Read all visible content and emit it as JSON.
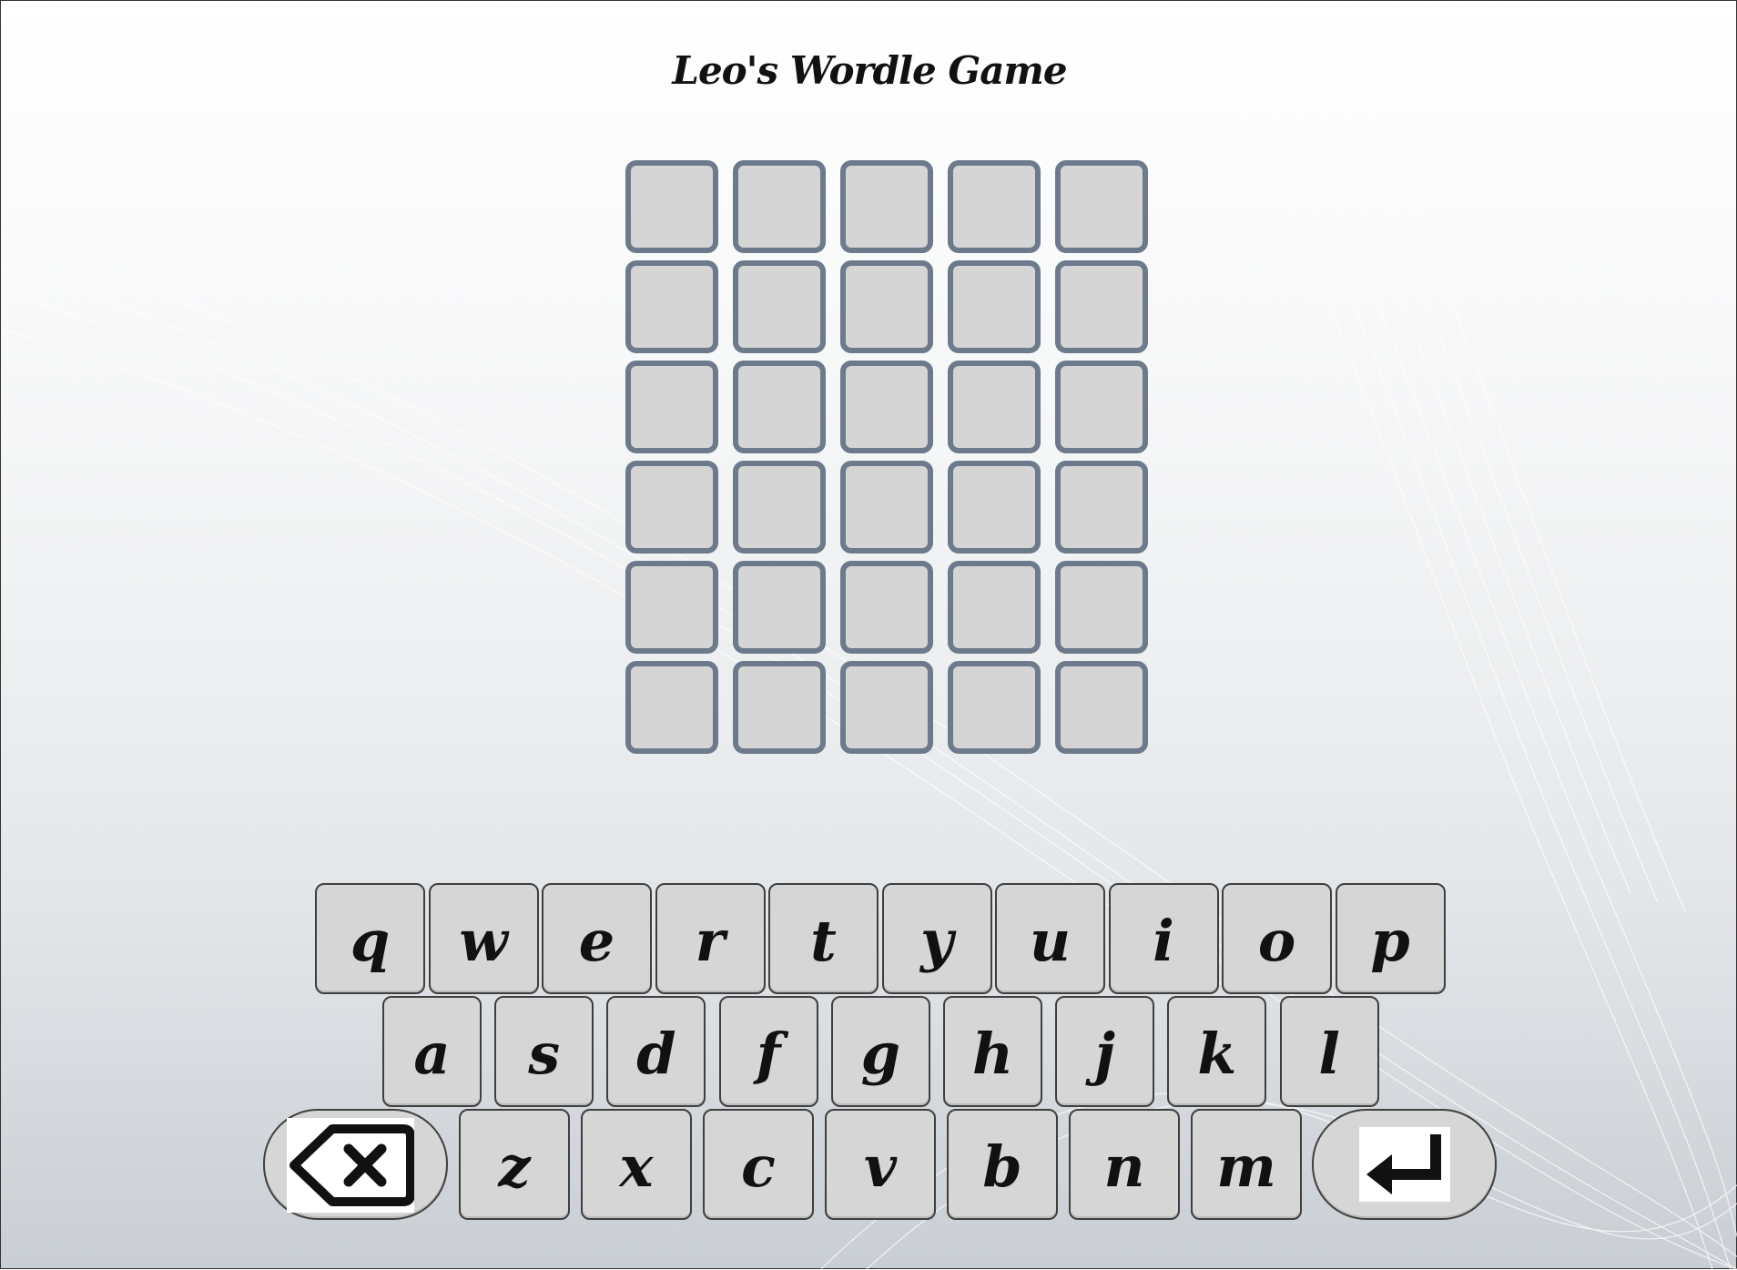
{
  "title": "Leo's Wordle Game",
  "board": {
    "rows": 6,
    "cols": 5,
    "letters": [
      [
        "",
        "",
        "",
        "",
        ""
      ],
      [
        "",
        "",
        "",
        "",
        ""
      ],
      [
        "",
        "",
        "",
        "",
        ""
      ],
      [
        "",
        "",
        "",
        "",
        ""
      ],
      [
        "",
        "",
        "",
        "",
        ""
      ],
      [
        "",
        "",
        "",
        "",
        ""
      ]
    ]
  },
  "keyboard": {
    "row1": [
      "q",
      "w",
      "e",
      "r",
      "t",
      "y",
      "u",
      "i",
      "o",
      "p"
    ],
    "row2": [
      "a",
      "s",
      "d",
      "f",
      "g",
      "h",
      "j",
      "k",
      "l"
    ],
    "row3": [
      "z",
      "x",
      "c",
      "v",
      "b",
      "n",
      "m"
    ],
    "backspace_icon": "backspace-icon",
    "enter_icon": "enter-icon"
  },
  "colors": {
    "tile_fill": "#d5d5d5",
    "tile_border": "#6c7a8b",
    "key_fill": "#d6d6d6",
    "key_border": "#3f3f3f"
  }
}
